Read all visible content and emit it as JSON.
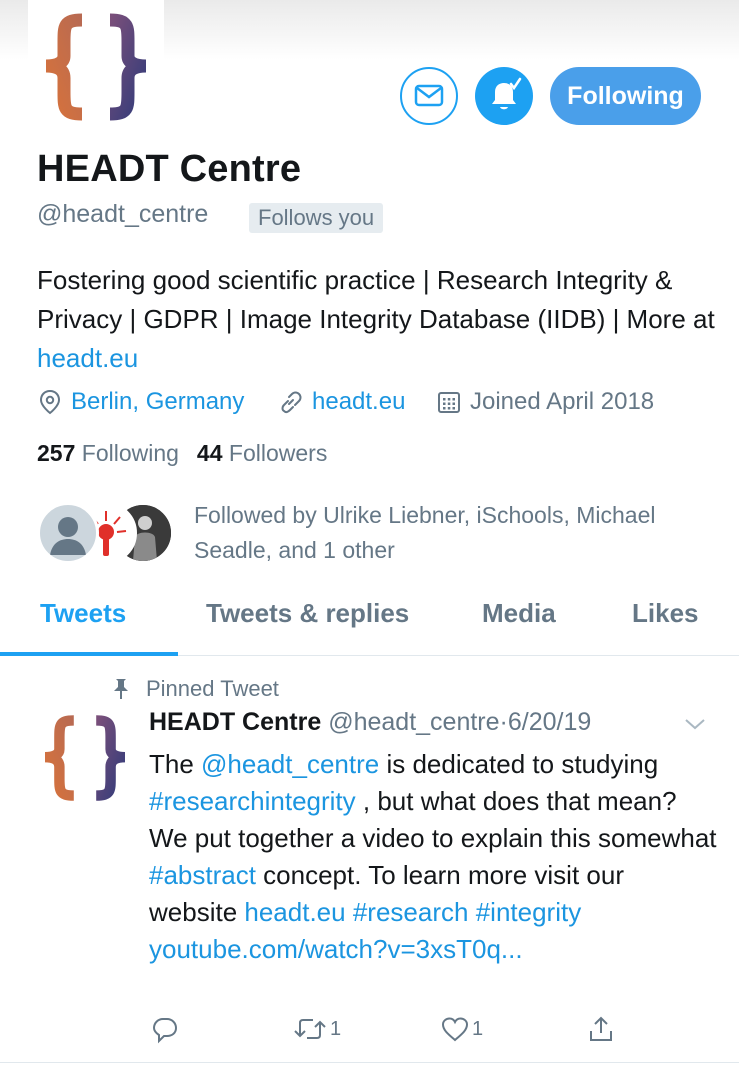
{
  "profile": {
    "name": "HEADT Centre",
    "handle": "@headt_centre",
    "follows_you": "Follows you",
    "bio": {
      "text": "Fostering good scientific practice | Research Integrity & Privacy | GDPR | Image Integrity Database (IIDB) | More at ",
      "link": "headt.eu"
    },
    "location": "Berlin, Germany",
    "website": "headt.eu",
    "joined": "Joined April 2018",
    "following_count": "257",
    "following_label": "Following",
    "followers_count": "44",
    "followers_label": "Followers",
    "followed_by": "Followed by Ulrike Liebner, iSchools, Michael Seadle, and 1 other"
  },
  "actions": {
    "following_button": "Following"
  },
  "tabs": [
    {
      "label": "Tweets",
      "active": true
    },
    {
      "label": "Tweets & replies",
      "active": false
    },
    {
      "label": "Media",
      "active": false
    },
    {
      "label": "Likes",
      "active": false
    }
  ],
  "pinned_tweet": {
    "pinned_label": "Pinned Tweet",
    "author_name": "HEADT Centre",
    "author_handle": "@headt_centre",
    "separator": "·",
    "date": "6/20/19",
    "text": {
      "t1": "The ",
      "mention": "@headt_centre",
      "t2": " is dedicated to studying ",
      "hashtag1": "#researchintegrity",
      "t3": " , but what does that mean? We put together a video to explain this somewhat ",
      "hashtag2": "#abstract",
      "t4": " concept. To learn more visit our website ",
      "link": "headt.eu",
      "hashtag3": "#research",
      "hashtag4": "#integrity",
      "url": "youtube.com/watch?v=3xsT0q..."
    },
    "reply_count": "",
    "retweet_count": "1",
    "like_count": "1"
  },
  "colors": {
    "accent": "#1da1f2",
    "link": "#1b95e0",
    "secondary_text": "#657786",
    "logo_orange": "#e07a3a",
    "logo_navy": "#3a3f7a"
  },
  "icons": {
    "mail": "mail-icon",
    "bell": "bell-icon",
    "location": "location-pin-icon",
    "link": "link-icon",
    "calendar": "calendar-icon",
    "pin": "pin-icon",
    "caret": "chevron-down-icon",
    "reply": "reply-icon",
    "retweet": "retweet-icon",
    "like": "heart-icon",
    "share": "share-icon"
  }
}
